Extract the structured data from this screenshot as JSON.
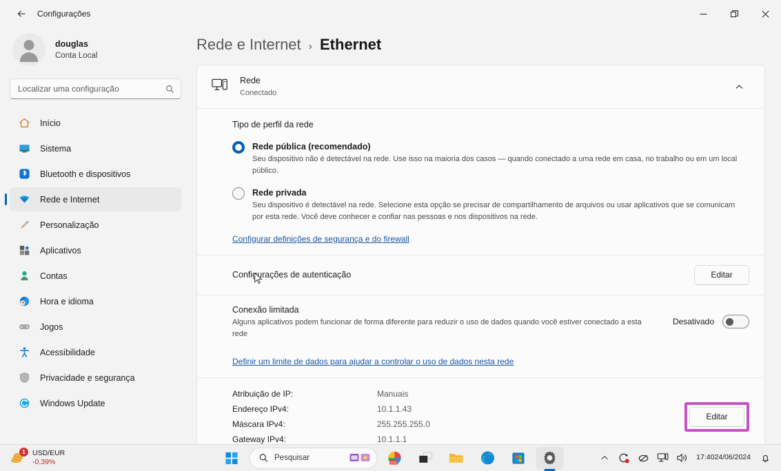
{
  "window": {
    "titlebar_title": "Configurações",
    "back_icon": "back-arrow-icon",
    "minimize": "—",
    "restore": "restore-icon",
    "close": "×"
  },
  "sidebar": {
    "account": {
      "name": "douglas",
      "type": "Conta Local",
      "avatar": "user-avatar-icon"
    },
    "search": {
      "placeholder": "Localizar uma configuração",
      "value": "",
      "icon": "search-icon"
    },
    "items": [
      {
        "label": "Início",
        "icon": "home-icon",
        "selected": false
      },
      {
        "label": "Sistema",
        "icon": "system-icon",
        "selected": false
      },
      {
        "label": "Bluetooth e dispositivos",
        "icon": "bluetooth-icon",
        "selected": false
      },
      {
        "label": "Rede e Internet",
        "icon": "wifi-icon",
        "selected": true
      },
      {
        "label": "Personalização",
        "icon": "brush-icon",
        "selected": false
      },
      {
        "label": "Aplicativos",
        "icon": "apps-icon",
        "selected": false
      },
      {
        "label": "Contas",
        "icon": "accounts-icon",
        "selected": false
      },
      {
        "label": "Hora e idioma",
        "icon": "clock-globe-icon",
        "selected": false
      },
      {
        "label": "Jogos",
        "icon": "gamepad-icon",
        "selected": false
      },
      {
        "label": "Acessibilidade",
        "icon": "accessibility-icon",
        "selected": false
      },
      {
        "label": "Privacidade e segurança",
        "icon": "shield-icon",
        "selected": false
      },
      {
        "label": "Windows Update",
        "icon": "update-icon",
        "selected": false
      }
    ]
  },
  "breadcrumb": {
    "parent": "Rede e Internet",
    "separator": "›",
    "current": "Ethernet"
  },
  "card": {
    "icon": "ethernet-pc-icon",
    "title": "Rede",
    "subtitle": "Conectado",
    "collapse_icon": "chevron-up-icon",
    "profile_section": {
      "label": "Tipo de perfil da rede",
      "options": [
        {
          "title": "Rede pública (recomendado)",
          "description": "Seu dispositivo não é detectável na rede. Use isso na maioria dos casos — quando conectado a uma rede em casa, no trabalho ou em um local público.",
          "selected": true
        },
        {
          "title": "Rede privada",
          "description": "Seu dispositivo é detectável na rede. Selecione esta opção se precisar de compartilhamento de arquivos ou usar aplicativos que se comunicam por esta rede. Você deve conhecer e confiar nas pessoas e nos dispositivos na rede.",
          "selected": false
        }
      ],
      "firewall_link": "Configurar definições de segurança e do firewall"
    },
    "auth_row": {
      "title": "Configurações de autenticação",
      "button": "Editar"
    },
    "metered_row": {
      "title": "Conexão limitada",
      "description": "Alguns aplicativos podem funcionar de forma diferente para reduzir o uso de dados quando você estiver conectado a esta rede",
      "toggle_label": "Desativado",
      "toggle_on": false,
      "data_limit_link": "Definir um limite de dados para ajudar a controlar o uso de dados nesta rede"
    },
    "ip_section": {
      "rows": [
        {
          "key": "Atribuição de IP:",
          "value": "Manuais"
        },
        {
          "key": "Endereço IPv4:",
          "value": "10.1.1.43"
        },
        {
          "key": "Máscara IPv4:",
          "value": "255.255.255.0"
        },
        {
          "key": "Gateway IPv4:",
          "value": "10.1.1.1"
        }
      ],
      "button": "Editar",
      "button_highlighted": true,
      "highlight_color": "#c653c6"
    }
  },
  "taskbar": {
    "widget": {
      "title": "USD/EUR",
      "change": "-0,39%",
      "badge": "1",
      "icon": "coins-icon"
    },
    "start_icon": "windows-start-icon",
    "search": {
      "placeholder": "Pesquisar",
      "icon": "search-icon"
    },
    "pinned": [
      {
        "name": "copilot-icon"
      },
      {
        "name": "task-view-icon"
      },
      {
        "name": "file-explorer-icon"
      },
      {
        "name": "edge-icon"
      },
      {
        "name": "microsoft-store-icon"
      },
      {
        "name": "settings-icon",
        "active": true
      }
    ],
    "tray": {
      "overflow_icon": "chevron-up-icon",
      "sync_icon": "sync-alert-icon",
      "mute_icon": "mic-muted-icon",
      "network_icon": "ethernet-icon",
      "volume_icon": "volume-icon",
      "time": "17:40",
      "date": "24/06/2024",
      "notifications_icon": "bell-icon"
    }
  }
}
